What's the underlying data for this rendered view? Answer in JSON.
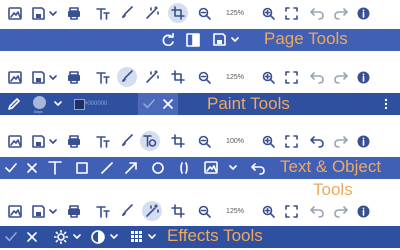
{
  "sections": [
    {
      "id": "page-tools",
      "caption": "Page Tools",
      "zoom": "125%"
    },
    {
      "id": "paint-tools",
      "caption": "Paint Tools",
      "zoom": "125%"
    },
    {
      "id": "text-object-tools",
      "caption_line1": "Text & Object",
      "caption_line2": "Tools",
      "zoom": "100%"
    },
    {
      "id": "effects-tools",
      "caption": "Effects Tools",
      "zoom": "125%"
    }
  ],
  "paint": {
    "hex": "#000000",
    "size_label": "0dpx"
  },
  "icons": {
    "toolbar": [
      "image-icon",
      "save-icon",
      "chevron-down-icon",
      "print-icon",
      "text-size-icon",
      "brush-icon",
      "magic-wand-icon",
      "crop-rotate-icon",
      "zoom-out-icon",
      "zoom-in-icon",
      "fullscreen-icon",
      "undo-icon",
      "redo-icon",
      "info-icon"
    ],
    "page": [
      "rotate-icon",
      "flip-icon",
      "save-icon",
      "chevron-down-icon"
    ],
    "paint": [
      "pencil-icon",
      "color-dot",
      "swatch",
      "check-icon",
      "close-icon",
      "more-icon"
    ],
    "text_object": [
      "check-icon",
      "close-icon",
      "text-icon",
      "rectangle-icon",
      "line-icon",
      "arrow-icon",
      "circle-icon",
      "brackets-icon",
      "image-icon",
      "chevron-down-icon",
      "undo-icon"
    ],
    "effects": [
      "check-icon",
      "close-icon",
      "brightness-icon",
      "contrast-icon",
      "grid-icon"
    ]
  },
  "colors": {
    "bar": "#3f60b4",
    "bar_dark": "#2f4f9f",
    "caption": "#f0a85e",
    "icon": "#3a4f8f",
    "active": "#d5deef"
  }
}
